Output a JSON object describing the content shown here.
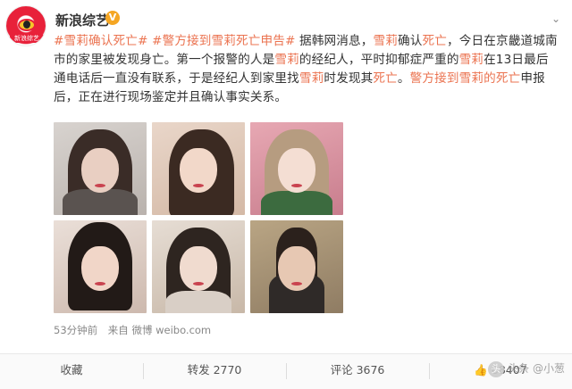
{
  "author": {
    "name": "新浪综艺",
    "badge": "V",
    "avatar_tag": "新浪综艺"
  },
  "post": {
    "segments": [
      {
        "text": "#雪莉确认死亡#",
        "style": "hash"
      },
      {
        "text": " ",
        "style": "plain"
      },
      {
        "text": "#警方接到雪莉死亡申告#",
        "style": "hash"
      },
      {
        "text": " 据韩网消息，",
        "style": "plain"
      },
      {
        "text": "雪莉",
        "style": "hl"
      },
      {
        "text": "确认",
        "style": "plain"
      },
      {
        "text": "死亡",
        "style": "hl"
      },
      {
        "text": "，今日在京畿道城南市的家里被发现身亡。第一个报警的人是",
        "style": "plain"
      },
      {
        "text": "雪莉",
        "style": "hl"
      },
      {
        "text": "的经纪人，平时抑郁症严重的",
        "style": "plain"
      },
      {
        "text": "雪莉",
        "style": "hl"
      },
      {
        "text": "在13日最后通电话后一直没有联系，于是经纪人到家里找",
        "style": "plain"
      },
      {
        "text": "雪莉",
        "style": "hl"
      },
      {
        "text": "时发现其",
        "style": "plain"
      },
      {
        "text": "死亡",
        "style": "hl"
      },
      {
        "text": "。",
        "style": "plain"
      },
      {
        "text": "警方接到",
        "style": "hl"
      },
      {
        "text": "雪莉",
        "style": "hl"
      },
      {
        "text": "的",
        "style": "hl"
      },
      {
        "text": "死亡",
        "style": "hl"
      },
      {
        "text": "申报后，正在进行现场鉴定并且确认事实关系。",
        "style": "plain"
      }
    ],
    "time": "53分钟前",
    "source_prefix": "来自",
    "source": "微博 weibo.com"
  },
  "actions": {
    "collect": "收藏",
    "repost": "转发 2770",
    "comment": "评论 3676",
    "like": "68407"
  },
  "watermark": "头条 @小葱"
}
